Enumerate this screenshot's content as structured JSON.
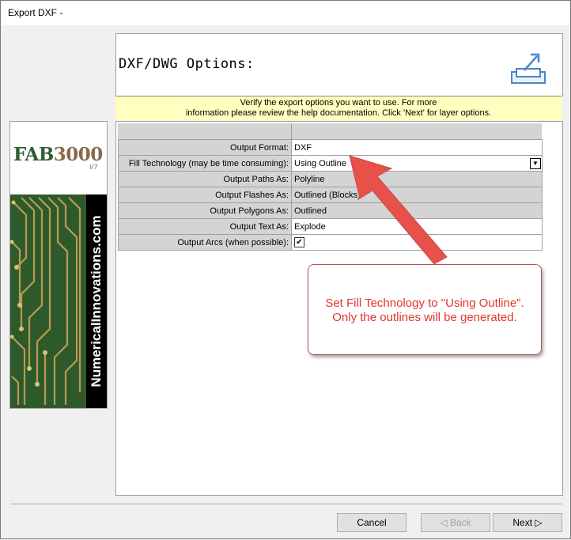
{
  "window": {
    "title": "Export DXF -"
  },
  "header": {
    "title": "DXF/DWG Options:",
    "icon": "export-icon"
  },
  "info": {
    "line1": "Verify the export options you want to use. For more",
    "line2": "information please review the help documentation. Click 'Next' for layer options."
  },
  "logo": {
    "brand_fab": "FAB",
    "brand_num": "3000",
    "version": "V7",
    "site": "NumericalInnovations.com"
  },
  "options": [
    {
      "label": "Output Format:",
      "value": "DXF"
    },
    {
      "label": "Fill Technology (may be time consuming):",
      "value": "Using Outline"
    },
    {
      "label": "Output Paths As:",
      "value": "Polyline"
    },
    {
      "label": "Output Flashes As:",
      "value": "Outlined (Blocks)"
    },
    {
      "label": "Output Polygons As:",
      "value": "Outlined"
    },
    {
      "label": "Output Text As:",
      "value": "Explode"
    },
    {
      "label": "Output Arcs (when possible):",
      "value": "✔",
      "checked": true
    }
  ],
  "callout": {
    "line1": "Set Fill Technology to \"Using Outline\".",
    "line2": "Only the outlines will be generated.",
    "color": "#e0362c"
  },
  "buttons": {
    "cancel": "Cancel",
    "back": "Back",
    "next": "Next"
  },
  "colors": {
    "info_bg": "#ffffc0",
    "callout_text": "#e0362c",
    "arrow": "#e8504a"
  }
}
